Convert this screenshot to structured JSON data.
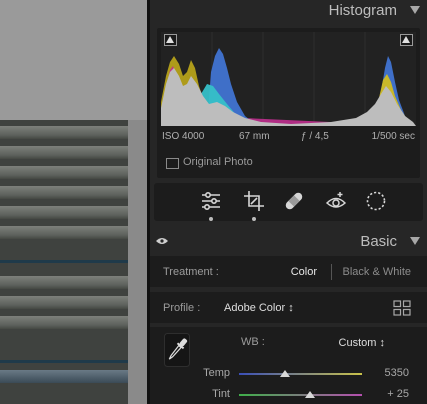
{
  "histogram": {
    "title": "Histogram",
    "iso": "ISO 4000",
    "focal_length": "67 mm",
    "aperture": "ƒ / 4,5",
    "shutter": "1/500 sec",
    "original_photo_label": "Original Photo"
  },
  "tools": [
    {
      "name": "edit-sliders-icon"
    },
    {
      "name": "crop-icon"
    },
    {
      "name": "healing-bandage-icon"
    },
    {
      "name": "red-eye-icon"
    },
    {
      "name": "masking-icon"
    }
  ],
  "basic": {
    "title": "Basic",
    "treatment_label": "Treatment :",
    "treatment_color": "Color",
    "treatment_bw": "Black & White",
    "profile_label": "Profile :",
    "profile_value": "Adobe Color ↕",
    "wb_label": "WB :",
    "wb_value": "Custom ↕",
    "temp_label": "Temp",
    "temp_value": "5350",
    "temp_level": 0.37,
    "tint_label": "Tint",
    "tint_value": "+ 25",
    "tint_level": 0.58
  },
  "colors": {
    "panel_bg": "#262626",
    "box_bg": "#1c1c1c",
    "temp_track_from": "#3a4fb8",
    "temp_track_to": "#c9c24a",
    "tint_track_from": "#3fae4a",
    "tint_track_to": "#b44fae"
  }
}
